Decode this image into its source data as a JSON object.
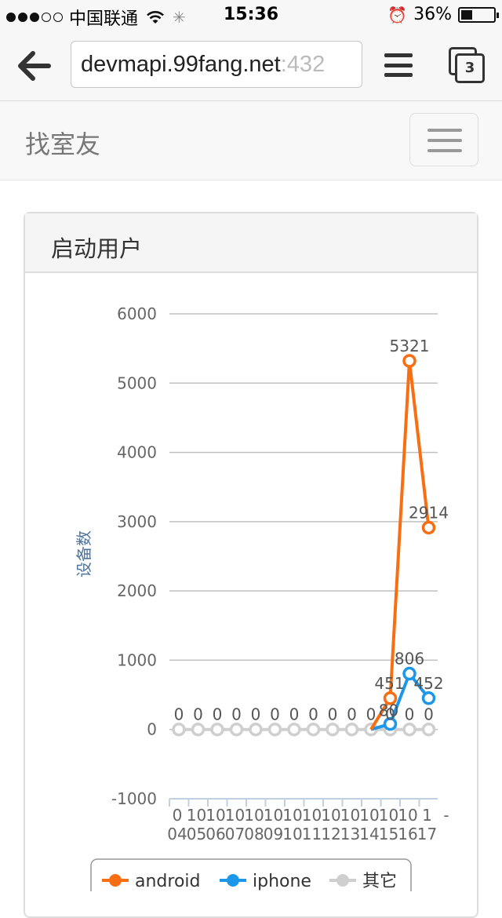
{
  "status_bar": {
    "carrier": "中国联通",
    "time": "15:36",
    "battery_percent": "36%"
  },
  "browser": {
    "url_host": "devmapi.99fang.net",
    "url_port": ":432",
    "tab_count": "3"
  },
  "navbar": {
    "brand": "找室友"
  },
  "panel": {
    "title": "启动用户"
  },
  "chart_data": {
    "type": "line",
    "title": "",
    "ylabel": "设备数",
    "xlabel": "",
    "ylim": [
      -1000,
      6000
    ],
    "yticks": [
      "6000",
      "5000",
      "4000",
      "3000",
      "2000",
      "1000",
      "0",
      "-1000"
    ],
    "categories": [
      "01-04",
      "01-05",
      "01-06",
      "01-07",
      "01-08",
      "01-09",
      "01-10",
      "01-11",
      "01-12",
      "01-13",
      "01-14",
      "01-15",
      "01-16",
      "01-17"
    ],
    "x_tick_lines": [
      [
        "0",
        "10",
        "10",
        "10",
        "10",
        "10",
        "10",
        "10",
        "10",
        "10",
        "10",
        "10",
        "10",
        "1",
        "-"
      ],
      [
        "04",
        "05",
        "06",
        "07",
        "08",
        "09",
        "10",
        "11",
        "12",
        "13",
        "14",
        "15",
        "16",
        "17"
      ]
    ],
    "series": [
      {
        "name": "android",
        "color": "#f86e13",
        "start_index": 10,
        "values": [
          0,
          451,
          5321,
          2914
        ],
        "labels": [
          "",
          "451",
          "5321",
          "2914"
        ]
      },
      {
        "name": "iphone",
        "color": "#1c97e9",
        "start_index": 10,
        "values": [
          0,
          80,
          806,
          452
        ],
        "labels": [
          "",
          "80",
          "806",
          "452"
        ]
      },
      {
        "name": "其它",
        "color": "#cfcfcf",
        "start_index": 0,
        "values": [
          0,
          0,
          0,
          0,
          0,
          0,
          0,
          0,
          0,
          0,
          0,
          0,
          0,
          0
        ],
        "labels": [
          "0",
          "0",
          "0",
          "0",
          "0",
          "0",
          "0",
          "0",
          "0",
          "0",
          "0",
          "0",
          "0",
          "0"
        ]
      }
    ],
    "grid": true,
    "legend_position": "bottom"
  }
}
